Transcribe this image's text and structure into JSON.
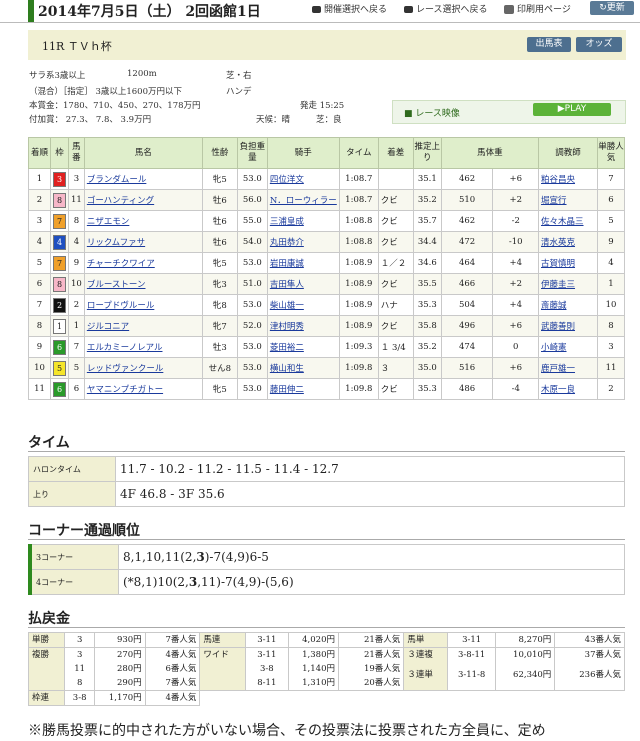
{
  "header": {
    "title": "2014年7月5日（土） 2回函館1日",
    "nav": [
      "開催選択へ戻る",
      "レース選択へ戻る",
      "印刷用ページ"
    ],
    "update": "更新"
  },
  "race": {
    "name": "11R ＴＶｈ杯",
    "buttons": [
      "出馬表",
      "オッズ"
    ],
    "class": "サラ系3歳以上",
    "distance": "1200m",
    "surface": "芝・右",
    "conditions": "（混合）［指定］ 3歳以上1600万円以下",
    "handicap": "ハンデ",
    "prize": "本賞金：1780、710、450、270、178万円",
    "post_time": "発走 15:25",
    "add_prize": "付加賞： 27.3、 7.8、 3.9万円",
    "weather": "天候：晴",
    "track": "芝：良",
    "video_label": "レース映像",
    "play_label": "▶PLAY"
  },
  "results": {
    "headers": [
      "着順",
      "枠",
      "馬番",
      "馬名",
      "性齢",
      "負担重量",
      "騎手",
      "タイム",
      "着差",
      "推定上り",
      "馬体重",
      "",
      "調教師",
      "単勝人気"
    ],
    "rows": [
      {
        "pos": "1",
        "waku": "3",
        "num": "3",
        "horse": "ブランダムール",
        "sex": "牝5",
        "wt": "53.0",
        "jockey": "四位洋文",
        "time": "1:08.7",
        "margin": "",
        "last": "35.1",
        "bw": "462",
        "diff": "+6",
        "trainer": "粕谷昌央",
        "pop": "7"
      },
      {
        "pos": "2",
        "waku": "8",
        "num": "11",
        "horse": "ゴーハンティング",
        "sex": "牡6",
        "wt": "56.0",
        "jockey": "N．ローウィラー",
        "time": "1:08.7",
        "margin": "クビ",
        "last": "35.2",
        "bw": "510",
        "diff": "+2",
        "trainer": "堀宣行",
        "pop": "6"
      },
      {
        "pos": "3",
        "waku": "7",
        "num": "8",
        "horse": "ニザエモン",
        "sex": "牡6",
        "wt": "55.0",
        "jockey": "三浦皇成",
        "time": "1:08.8",
        "margin": "クビ",
        "last": "35.7",
        "bw": "462",
        "diff": "-2",
        "trainer": "佐々木晶三",
        "pop": "5"
      },
      {
        "pos": "4",
        "waku": "4",
        "num": "4",
        "horse": "リックムファサ",
        "sex": "牡6",
        "wt": "54.0",
        "jockey": "丸田恭介",
        "time": "1:08.8",
        "margin": "クビ",
        "last": "34.4",
        "bw": "472",
        "diff": "-10",
        "trainer": "清水英克",
        "pop": "9"
      },
      {
        "pos": "5",
        "waku": "7",
        "num": "9",
        "horse": "チャーチクワイア",
        "sex": "牝5",
        "wt": "53.0",
        "jockey": "岩田康誠",
        "time": "1:08.9",
        "margin": "１／２",
        "last": "34.6",
        "bw": "464",
        "diff": "+4",
        "trainer": "古賀慎明",
        "pop": "4"
      },
      {
        "pos": "6",
        "waku": "8",
        "num": "10",
        "horse": "ブルーストーン",
        "sex": "牝3",
        "wt": "51.0",
        "jockey": "吉田隼人",
        "time": "1:08.9",
        "margin": "クビ",
        "last": "35.5",
        "bw": "466",
        "diff": "+2",
        "trainer": "伊藤圭三",
        "pop": "1"
      },
      {
        "pos": "7",
        "waku": "2",
        "num": "2",
        "horse": "ロープドヴルール",
        "sex": "牝8",
        "wt": "53.0",
        "jockey": "柴山雄一",
        "time": "1:08.9",
        "margin": "ハナ",
        "last": "35.3",
        "bw": "504",
        "diff": "+4",
        "trainer": "斎藤誠",
        "pop": "10"
      },
      {
        "pos": "8",
        "waku": "1",
        "num": "1",
        "horse": "ジルコニア",
        "sex": "牝7",
        "wt": "52.0",
        "jockey": "津村明秀",
        "time": "1:08.9",
        "margin": "クビ",
        "last": "35.8",
        "bw": "496",
        "diff": "+6",
        "trainer": "武藤善則",
        "pop": "8"
      },
      {
        "pos": "9",
        "waku": "6",
        "num": "7",
        "horse": "エルカミーノレアル",
        "sex": "牡3",
        "wt": "53.0",
        "jockey": "菱田裕二",
        "time": "1:09.3",
        "margin": "１ 3/4",
        "last": "35.2",
        "bw": "474",
        "diff": "0",
        "trainer": "小崎憲",
        "pop": "3"
      },
      {
        "pos": "10",
        "waku": "5",
        "num": "5",
        "horse": "レッドヴァンクール",
        "sex": "せん8",
        "wt": "53.0",
        "jockey": "横山和生",
        "time": "1:09.8",
        "margin": "３",
        "last": "35.0",
        "bw": "516",
        "diff": "+6",
        "trainer": "鹿戸雄一",
        "pop": "11"
      },
      {
        "pos": "11",
        "waku": "6",
        "num": "6",
        "horse": "ヤマニンプチガトー",
        "sex": "牝5",
        "wt": "53.0",
        "jockey": "藤田伸二",
        "time": "1:09.8",
        "margin": "クビ",
        "last": "35.3",
        "bw": "486",
        "diff": "-4",
        "trainer": "木原一良",
        "pop": "2"
      }
    ]
  },
  "time_section": {
    "title": "タイム",
    "furlong_label": "ハロンタイム",
    "furlong": "11.7 - 10.2 - 11.2 - 11.5 - 11.4 - 12.7",
    "agari_label": "上り",
    "agari": "4F 46.8 - 3F 35.6"
  },
  "corner_section": {
    "title": "コーナー通過順位",
    "c3_label": "3コーナー",
    "c3_a": "8,1,10,11(2,",
    "c3_b": "3",
    "c3_c": ")-7(4,9)6-5",
    "c4_label": "4コーナー",
    "c4_a": "(*8,1)10(2,",
    "c4_b": "3",
    "c4_c": ",11)-7(4,9)-(5,6)"
  },
  "payout": {
    "title": "払戻金",
    "tansho": {
      "label": "単勝",
      "num": "3",
      "pay": "930円",
      "pop": "7番人気"
    },
    "fukusho": {
      "label": "複勝",
      "nums": [
        "3",
        "11",
        "8"
      ],
      "pays": [
        "270円",
        "280円",
        "290円"
      ],
      "pops": [
        "4番人気",
        "6番人気",
        "7番人気"
      ]
    },
    "wakuren": {
      "label": "枠連",
      "num": "3-8",
      "pay": "1,170円",
      "pop": "4番人気"
    },
    "umaren": {
      "label": "馬連",
      "num": "3-11",
      "pay": "4,020円",
      "pop": "21番人気"
    },
    "wide": {
      "label": "ワイド",
      "nums": [
        "3-11",
        "3-8",
        "8-11"
      ],
      "pays": [
        "1,380円",
        "1,140円",
        "1,310円"
      ],
      "pops": [
        "21番人気",
        "19番人気",
        "20番人気"
      ]
    },
    "umatan": {
      "label": "馬単",
      "num": "3-11",
      "pay": "8,270円",
      "pop": "43番人気"
    },
    "sanrenpuku": {
      "label": "３連複",
      "num": "3-8-11",
      "pay": "10,010円",
      "pop": "37番人気"
    },
    "sanrentan": {
      "label": "３連単",
      "num": "3-11-8",
      "pay": "62,340円",
      "pop": "236番人気"
    }
  },
  "note": "※勝馬投票に的中された方がいない場合、その投票法に投票された方全員に、定め",
  "colors": {
    "accent_green": "#2e7d1e",
    "header_bg": "#dfeecb",
    "banner_bg": "#f1f0d3",
    "link": "#1a3a9c"
  }
}
